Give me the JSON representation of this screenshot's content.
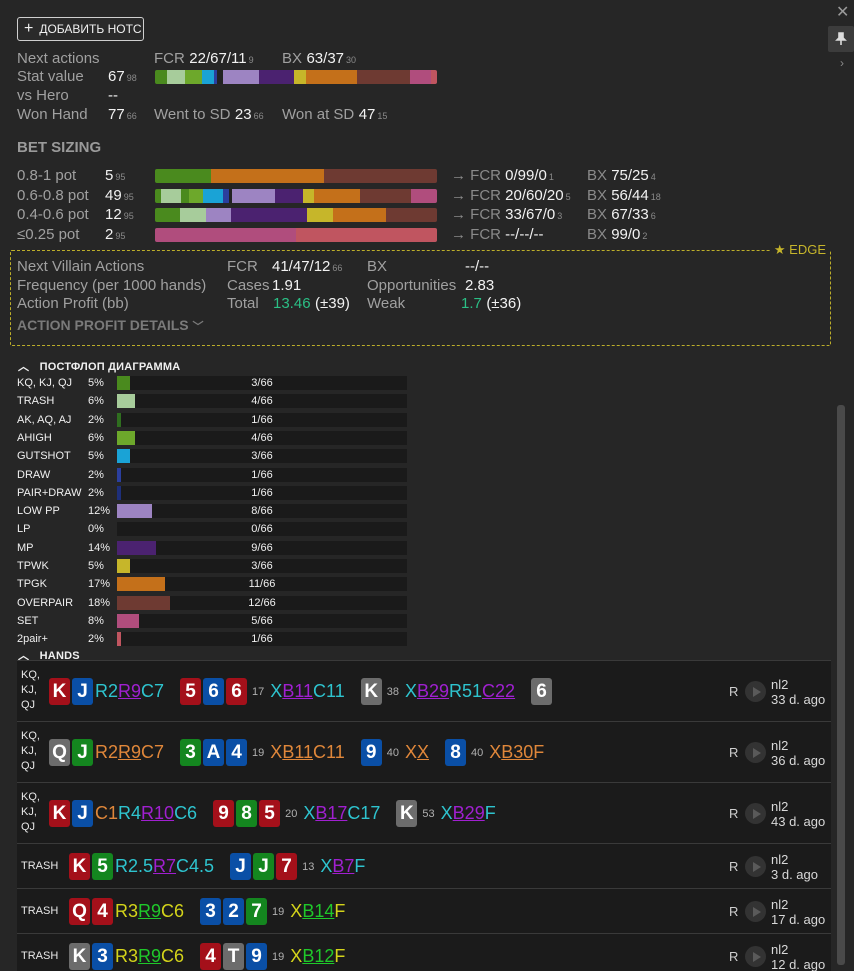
{
  "add_note_label": "ДОБАВИТЬ НОТС",
  "edge_label": "EDGE",
  "top": {
    "next_actions_label": "Next actions",
    "fcr_label": "FCR",
    "fcr_value": "22/67/11",
    "fcr_count": "9",
    "bx_label": "BX",
    "bx_value": "63/37",
    "bx_count": "30",
    "stat_value_label": "Stat value",
    "stat_value": "67",
    "stat_count": "98",
    "vs_hero_label": "vs Hero",
    "vs_hero_value": "--",
    "won_hand_label": "Won Hand",
    "won_hand_value": "77",
    "won_hand_count": "66",
    "went_sd_label": "Went to SD",
    "went_sd_value": "23",
    "went_sd_count": "66",
    "won_sd_label": "Won at SD",
    "won_sd_value": "47",
    "won_sd_count": "15"
  },
  "stat_bar": [
    [
      "#4a8a1e",
      4
    ],
    [
      "#a7cc9b",
      6
    ],
    [
      "#6da82b",
      6
    ],
    [
      "#1aa3d6",
      4
    ],
    [
      "#2b3f9e",
      1
    ],
    [
      "#222",
      2
    ],
    [
      "#9d84c2",
      12
    ],
    [
      "#4b2270",
      12
    ],
    [
      "#c6b62a",
      4
    ],
    [
      "#c4701a",
      17
    ],
    [
      "#6e3a32",
      18
    ],
    [
      "#b04d7d",
      7
    ],
    [
      "#c05560",
      2
    ]
  ],
  "bet_sizing": {
    "title": "BET SIZING",
    "rows": [
      {
        "label": "0.8-1 pot",
        "value": "5",
        "count": "95",
        "fcr": "0/99/0",
        "fcr_count": "1",
        "bx": "75/25",
        "bx_count": "4",
        "bar": [
          [
            "#4a8a1e",
            20
          ],
          [
            "#c4701a",
            40
          ],
          [
            "#6e3a32",
            40
          ]
        ]
      },
      {
        "label": "0.6-0.8 pot",
        "value": "49",
        "count": "95",
        "fcr": "20/60/20",
        "fcr_count": "5",
        "bx": "56/44",
        "bx_count": "18",
        "bar": [
          [
            "#4a8a1e",
            2
          ],
          [
            "#a7cc9b",
            7
          ],
          [
            "#4a8a1e",
            3
          ],
          [
            "#6da82b",
            5
          ],
          [
            "#1aa3d6",
            7
          ],
          [
            "#2b3f9e",
            2
          ],
          [
            "#222",
            1
          ],
          [
            "#9d84c2",
            15
          ],
          [
            "#4b2270",
            10
          ],
          [
            "#c6b62a",
            4
          ],
          [
            "#c4701a",
            16
          ],
          [
            "#6e3a32",
            18
          ],
          [
            "#b04d7d",
            9
          ]
        ]
      },
      {
        "label": "0.4-0.6 pot",
        "value": "12",
        "count": "95",
        "fcr": "33/67/0",
        "fcr_count": "3",
        "bx": "67/33",
        "bx_count": "6",
        "bar": [
          [
            "#4a8a1e",
            9
          ],
          [
            "#a7cc9b",
            9
          ],
          [
            "#9d84c2",
            9
          ],
          [
            "#4b2270",
            27
          ],
          [
            "#c6b62a",
            9
          ],
          [
            "#c4701a",
            19
          ],
          [
            "#6e3a32",
            18
          ]
        ]
      },
      {
        "label": "≤0.25 pot",
        "value": "2",
        "count": "95",
        "fcr": "--/--/--",
        "fcr_count": "",
        "bx": "99/0",
        "bx_count": "2",
        "bar": [
          [
            "#b04d7d",
            50
          ],
          [
            "#c05560",
            50
          ]
        ]
      }
    ]
  },
  "edge": {
    "next_villain_label": "Next Villain Actions",
    "fcr_label": "FCR",
    "fcr_value": "41/47/12",
    "fcr_count": "66",
    "bx_label": "BX",
    "bx_value": "--/--",
    "frequency_label": "Frequency (per 1000 hands)",
    "cases_label": "Cases",
    "cases_value": "1.91",
    "opp_label": "Opportunities",
    "opp_value": "2.83",
    "profit_label": "Action Profit (bb)",
    "total_label": "Total",
    "total_value": "13.46",
    "total_ci": "(±39)",
    "weak_label": "Weak",
    "weak_value": "1.7",
    "weak_ci": "(±36)",
    "details_label": "ACTION PROFIT DETAILS"
  },
  "postflop": {
    "title": "ПОСТФЛОП ДИАГРАММА",
    "rows": [
      {
        "name": "KQ, KJ, QJ",
        "pct": "5%",
        "count": "3/66",
        "frac": 0.045,
        "color": "#4a8a1e"
      },
      {
        "name": "TRASH",
        "pct": "6%",
        "count": "4/66",
        "frac": 0.061,
        "color": "#a7cc9b"
      },
      {
        "name": "AK, AQ, AJ",
        "pct": "2%",
        "count": "1/66",
        "frac": 0.015,
        "color": "#2f6e1f"
      },
      {
        "name": "AHIGH",
        "pct": "6%",
        "count": "4/66",
        "frac": 0.061,
        "color": "#6da82b"
      },
      {
        "name": "GUTSHOT",
        "pct": "5%",
        "count": "3/66",
        "frac": 0.045,
        "color": "#1aa3d6"
      },
      {
        "name": "DRAW",
        "pct": "2%",
        "count": "1/66",
        "frac": 0.015,
        "color": "#2b3f9e"
      },
      {
        "name": "PAIR+DRAW",
        "pct": "2%",
        "count": "1/66",
        "frac": 0.015,
        "color": "#1e2f7a"
      },
      {
        "name": "LOW PP",
        "pct": "12%",
        "count": "8/66",
        "frac": 0.121,
        "color": "#9d84c2"
      },
      {
        "name": "LP",
        "pct": "0%",
        "count": "0/66",
        "frac": 0,
        "color": "#7a5aa0"
      },
      {
        "name": "MP",
        "pct": "14%",
        "count": "9/66",
        "frac": 0.136,
        "color": "#4b2270"
      },
      {
        "name": "TPWK",
        "pct": "5%",
        "count": "3/66",
        "frac": 0.045,
        "color": "#c6b62a"
      },
      {
        "name": "TPGK",
        "pct": "17%",
        "count": "11/66",
        "frac": 0.167,
        "color": "#c4701a"
      },
      {
        "name": "OVERPAIR",
        "pct": "18%",
        "count": "12/66",
        "frac": 0.182,
        "color": "#6e3a32"
      },
      {
        "name": "SET",
        "pct": "8%",
        "count": "5/66",
        "frac": 0.076,
        "color": "#b04d7d"
      },
      {
        "name": "2pair+",
        "pct": "2%",
        "count": "1/66",
        "frac": 0.015,
        "color": "#c05560"
      }
    ]
  },
  "hands": {
    "title": "HANDS",
    "rows": [
      {
        "cat": [
          "KQ,",
          "KJ,",
          "QJ"
        ],
        "seq": [
          [
            "c",
            "K",
            "r"
          ],
          [
            "c",
            "J",
            "b"
          ],
          [
            "a",
            "R2 ",
            "#2ec4cf",
            0
          ],
          [
            "a",
            "R9",
            "#a020d0",
            1
          ],
          [
            "a",
            " C7",
            "#2ec4cf",
            0
          ],
          [
            "g"
          ],
          [
            "c",
            "5",
            "r"
          ],
          [
            "c",
            "6",
            "b"
          ],
          [
            "c",
            "6",
            "r"
          ],
          [
            "n",
            "17"
          ],
          [
            "a",
            "X ",
            "#2ec4cf",
            0
          ],
          [
            "a",
            "B11",
            "#a020d0",
            1
          ],
          [
            "a",
            " C11",
            "#2ec4cf",
            0
          ],
          [
            "g"
          ],
          [
            "c",
            "K",
            "k"
          ],
          [
            "n",
            "38"
          ],
          [
            "a",
            "X ",
            "#2ec4cf",
            0
          ],
          [
            "a",
            "B29",
            "#a020d0",
            1
          ],
          [
            "a",
            " R51 ",
            "#2ec4cf",
            0
          ],
          [
            "a",
            "C22",
            "#a020d0",
            1
          ],
          [
            "g"
          ],
          [
            "c",
            "6",
            "k"
          ]
        ],
        "r": "R",
        "stake": "nl2",
        "ago": "33 d. ago"
      },
      {
        "cat": [
          "KQ,",
          "KJ,",
          "QJ"
        ],
        "seq": [
          [
            "c",
            "Q",
            "k"
          ],
          [
            "c",
            "J",
            "g"
          ],
          [
            "a",
            "R2 ",
            "#e0873a",
            0
          ],
          [
            "a",
            "R9",
            "#e0873a",
            1
          ],
          [
            "a",
            " C7",
            "#e0873a",
            0
          ],
          [
            "g"
          ],
          [
            "c",
            "3",
            "g"
          ],
          [
            "c",
            "A",
            "b"
          ],
          [
            "c",
            "4",
            "b"
          ],
          [
            "n",
            "19"
          ],
          [
            "a",
            "X ",
            "#e0873a",
            0
          ],
          [
            "a",
            "B11",
            "#e0873a",
            1
          ],
          [
            "a",
            " C11",
            "#e0873a",
            0
          ],
          [
            "g"
          ],
          [
            "c",
            "9",
            "b"
          ],
          [
            "n",
            "40"
          ],
          [
            "a",
            "X ",
            "#e0873a",
            0
          ],
          [
            "a",
            "X",
            "#e0873a",
            1
          ],
          [
            "g"
          ],
          [
            "c",
            "8",
            "b"
          ],
          [
            "n",
            "40"
          ],
          [
            "a",
            "X ",
            "#e0873a",
            0
          ],
          [
            "a",
            "B30",
            "#e0873a",
            1
          ],
          [
            "a",
            " F",
            "#e0873a",
            0
          ]
        ],
        "r": "R",
        "stake": "nl2",
        "ago": "36 d. ago"
      },
      {
        "cat": [
          "KQ,",
          "KJ,",
          "QJ"
        ],
        "seq": [
          [
            "c",
            "K",
            "r"
          ],
          [
            "c",
            "J",
            "b"
          ],
          [
            "a",
            "C1 ",
            "#e0873a",
            0
          ],
          [
            "a",
            "R4 ",
            "#2ec4cf",
            0
          ],
          [
            "a",
            "R10",
            "#a020d0",
            1
          ],
          [
            "a",
            " C6",
            "#2ec4cf",
            0
          ],
          [
            "g"
          ],
          [
            "c",
            "9",
            "r"
          ],
          [
            "c",
            "8",
            "g"
          ],
          [
            "c",
            "5",
            "r"
          ],
          [
            "n",
            "20"
          ],
          [
            "a",
            "X ",
            "#2ec4cf",
            0
          ],
          [
            "a",
            "B17",
            "#a020d0",
            1
          ],
          [
            "a",
            " C17",
            "#2ec4cf",
            0
          ],
          [
            "g"
          ],
          [
            "c",
            "K",
            "k"
          ],
          [
            "n",
            "53"
          ],
          [
            "a",
            "X ",
            "#2ec4cf",
            0
          ],
          [
            "a",
            "B29",
            "#a020d0",
            1
          ],
          [
            "a",
            " F",
            "#2ec4cf",
            0
          ]
        ],
        "r": "R",
        "stake": "nl2",
        "ago": "43 d. ago"
      },
      {
        "cat": [
          "TRASH"
        ],
        "seq": [
          [
            "c",
            "K",
            "r"
          ],
          [
            "c",
            "5",
            "g"
          ],
          [
            "a",
            "R2.5 ",
            "#2ec4cf",
            0
          ],
          [
            "a",
            "R7",
            "#a020d0",
            1
          ],
          [
            "a",
            " C4.5",
            "#2ec4cf",
            0
          ],
          [
            "g"
          ],
          [
            "c",
            "J",
            "b"
          ],
          [
            "c",
            "J",
            "g"
          ],
          [
            "c",
            "7",
            "r"
          ],
          [
            "n",
            "13"
          ],
          [
            "a",
            "X ",
            "#2ec4cf",
            0
          ],
          [
            "a",
            "B7",
            "#a020d0",
            1
          ],
          [
            "a",
            " F",
            "#2ec4cf",
            0
          ]
        ],
        "r": "R",
        "stake": "nl2",
        "ago": "3 d. ago"
      },
      {
        "cat": [
          "TRASH"
        ],
        "seq": [
          [
            "c",
            "Q",
            "r"
          ],
          [
            "c",
            "4",
            "r"
          ],
          [
            "a",
            "R3 ",
            "#d4d41a",
            0
          ],
          [
            "a",
            "R9",
            "#1fc82a",
            1
          ],
          [
            "a",
            " C6",
            "#d4d41a",
            0
          ],
          [
            "g"
          ],
          [
            "c",
            "3",
            "b"
          ],
          [
            "c",
            "2",
            "b"
          ],
          [
            "c",
            "7",
            "g"
          ],
          [
            "n",
            "19"
          ],
          [
            "a",
            "X ",
            "#d4d41a",
            0
          ],
          [
            "a",
            "B14",
            "#1fc82a",
            1
          ],
          [
            "a",
            " F",
            "#d4d41a",
            0
          ]
        ],
        "r": "R",
        "stake": "nl2",
        "ago": "17 d. ago"
      },
      {
        "cat": [
          "TRASH"
        ],
        "seq": [
          [
            "c",
            "K",
            "k"
          ],
          [
            "c",
            "3",
            "b"
          ],
          [
            "a",
            "R3 ",
            "#d4d41a",
            0
          ],
          [
            "a",
            "R9",
            "#1fc82a",
            1
          ],
          [
            "a",
            " C6",
            "#d4d41a",
            0
          ],
          [
            "g"
          ],
          [
            "c",
            "4",
            "r"
          ],
          [
            "c",
            "T",
            "k"
          ],
          [
            "c",
            "9",
            "b"
          ],
          [
            "n",
            "19"
          ],
          [
            "a",
            "X ",
            "#d4d41a",
            0
          ],
          [
            "a",
            "B12",
            "#1fc82a",
            1
          ],
          [
            "a",
            " F",
            "#d4d41a",
            0
          ]
        ],
        "r": "R",
        "stake": "nl2",
        "ago": "12 d. ago"
      }
    ]
  }
}
